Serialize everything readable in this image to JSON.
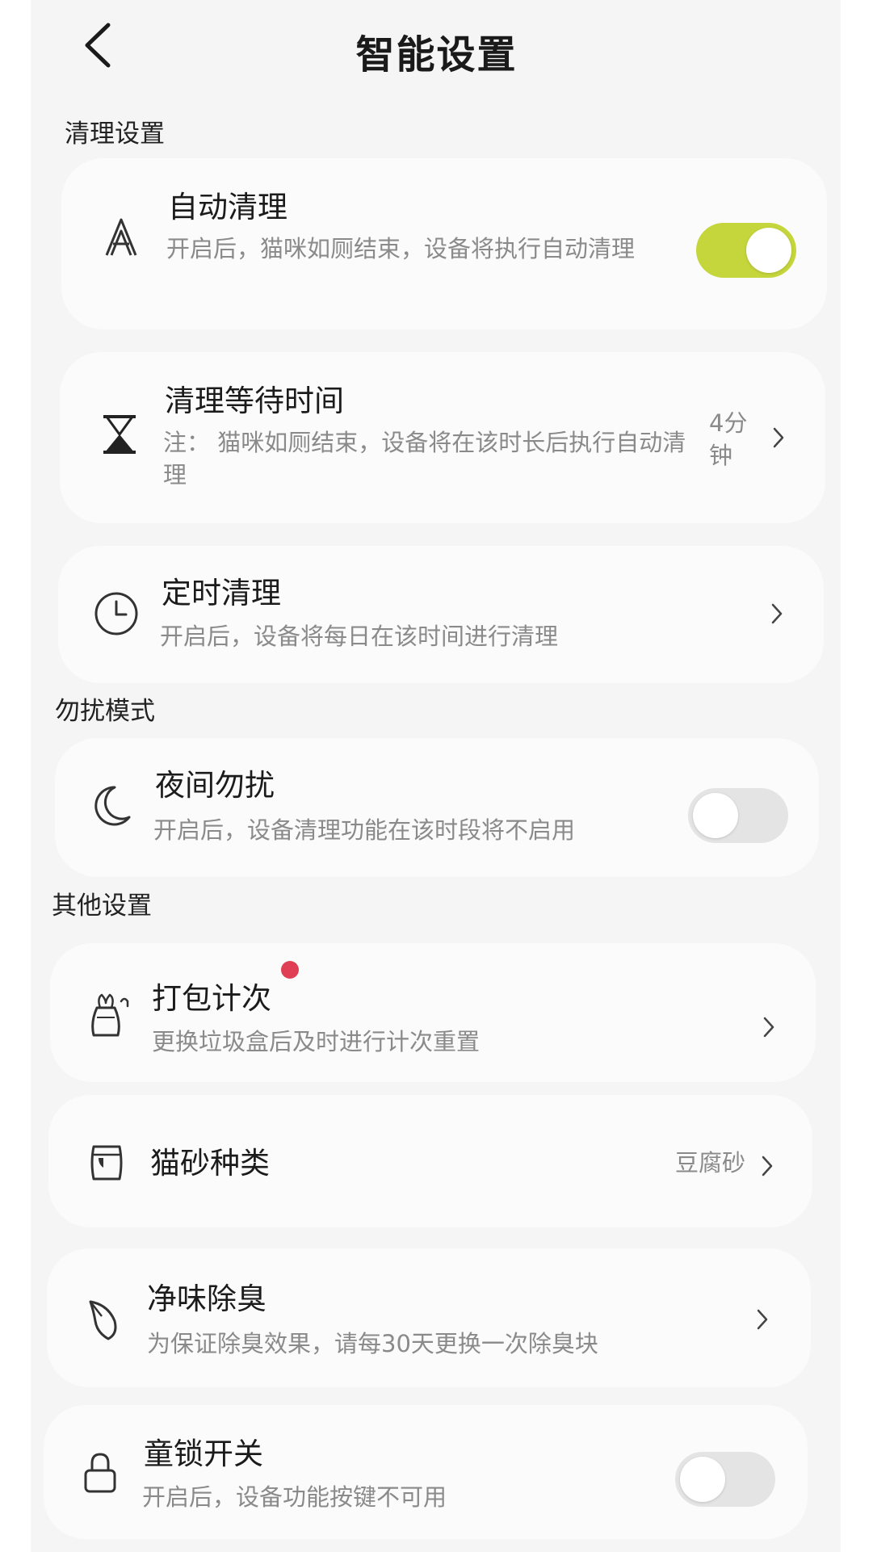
{
  "header": {
    "title": "智能设置"
  },
  "sections": {
    "cleaning": "清理设置",
    "dnd": "勿扰模式",
    "other": "其他设置"
  },
  "items": {
    "auto_clean": {
      "label": "自动清理",
      "desc": "开启后，猫咪如厕结束，设备将执行自动清理",
      "toggle": "on",
      "icon": "letter-a-icon"
    },
    "wait_time": {
      "label": "清理等待时间",
      "desc": "注： 猫咪如厕结束，设备将在该时长后执行自动清理",
      "value": "4分钟",
      "icon": "hourglass-icon"
    },
    "scheduled_clean": {
      "label": "定时清理",
      "desc": "开启后，设备将每日在该时间进行清理",
      "icon": "clock-icon"
    },
    "night_dnd": {
      "label": "夜间勿扰",
      "desc": "开启后，设备清理功能在该时段将不启用",
      "toggle": "off",
      "icon": "moon-icon"
    },
    "bag_count": {
      "label": "打包计次",
      "desc": "更换垃圾盒后及时进行计次重置",
      "icon": "trash-bag-icon",
      "badge": "red-dot"
    },
    "litter_type": {
      "label": "猫砂种类",
      "value": "豆腐砂",
      "icon": "litter-bag-icon"
    },
    "deodorize": {
      "label": "净味除臭",
      "desc": "为保证除臭效果，请每30天更换一次除臭块",
      "icon": "leaf-icon"
    },
    "child_lock": {
      "label": "童锁开关",
      "desc": "开启后，设备功能按键不可用",
      "toggle": "off",
      "icon": "lock-icon"
    }
  },
  "colors": {
    "accent": "#c5d53c",
    "toggle_off": "#e4e4e4",
    "badge": "#e03e55",
    "background": "#f5f5f5",
    "card": "#fbfbfb"
  }
}
